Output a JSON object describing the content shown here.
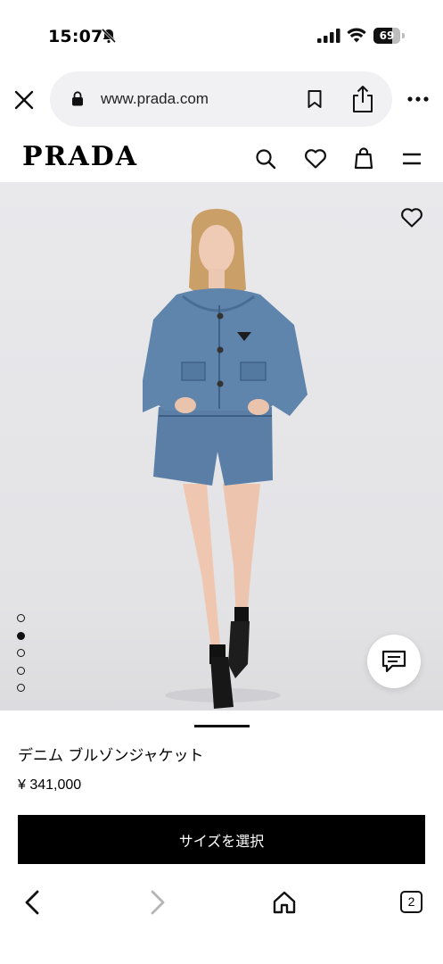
{
  "status_bar": {
    "time": "15:07",
    "battery_level": "69",
    "icons": [
      "bell-muted-icon",
      "signal-icon",
      "wifi-icon",
      "battery-icon"
    ]
  },
  "browser": {
    "url": "www.prada.com",
    "icons": [
      "close-icon",
      "lock-icon",
      "bookmark-icon",
      "share-icon",
      "more-icon"
    ]
  },
  "site_header": {
    "logo": "PRADA",
    "icons": [
      "search-icon",
      "heart-icon",
      "bag-icon",
      "menu-icon"
    ]
  },
  "gallery": {
    "slide_count": 5,
    "active_slide": 2,
    "background": "#e6e6e9",
    "icons": [
      "favorite-heart-icon",
      "chat-icon"
    ]
  },
  "product": {
    "name": "デニム ブルゾンジャケット",
    "price": "¥ 341,000",
    "select_size_label": "サイズを選択"
  },
  "bottom_bar": {
    "tab_count": "2",
    "icons": [
      "back-arrow-icon",
      "forward-arrow-icon",
      "home-icon",
      "tabs-icon"
    ]
  },
  "colors": {
    "accent": "#000000",
    "url_bar_bg": "#f1f1f3",
    "disabled": "#b5b5b8"
  }
}
